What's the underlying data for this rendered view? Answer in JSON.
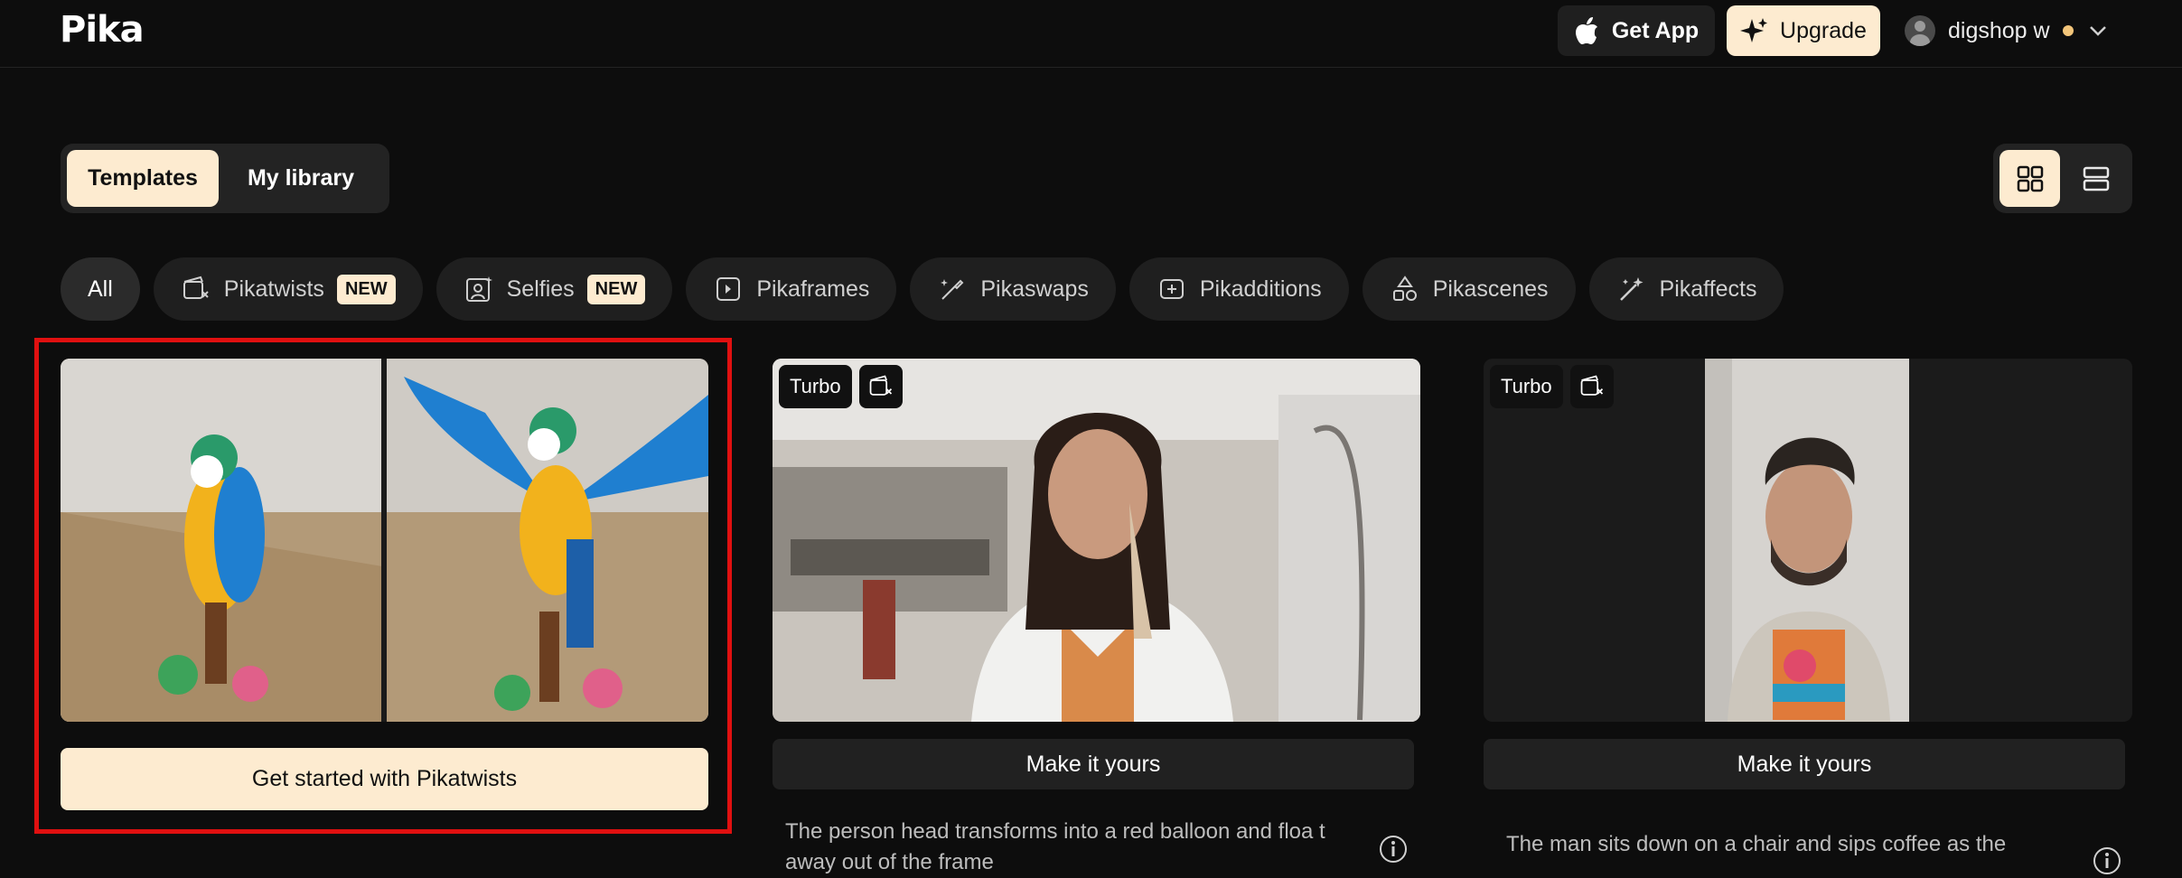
{
  "header": {
    "logo": "Pika",
    "get_app_label": "Get App",
    "upgrade_label": "Upgrade",
    "user_name": "digshop w"
  },
  "tabs": [
    {
      "label": "Templates",
      "active": true
    },
    {
      "label": "My library",
      "active": false
    }
  ],
  "filters": [
    {
      "label": "All",
      "icon": "none"
    },
    {
      "label": "Pikatwists",
      "icon": "twist-icon",
      "badge": "NEW"
    },
    {
      "label": "Selfies",
      "icon": "selfie-icon",
      "badge": "NEW"
    },
    {
      "label": "Pikaframes",
      "icon": "frames-icon"
    },
    {
      "label": "Pikaswaps",
      "icon": "swap-icon"
    },
    {
      "label": "Pikadditions",
      "icon": "additions-icon"
    },
    {
      "label": "Pikascenes",
      "icon": "scenes-icon"
    },
    {
      "label": "Pikaffects",
      "icon": "effects-icon"
    }
  ],
  "cards": [
    {
      "cta": "Get started with Pikatwists"
    },
    {
      "tag": "Turbo",
      "cta": "Make it yours",
      "description": "The person head transforms into a red balloon and floa t away out of the frame"
    },
    {
      "tag": "Turbo",
      "cta": "Make it yours",
      "description": "The man sits down on a chair and sips coffee as the"
    }
  ],
  "colors": {
    "background": "#0d0d0d",
    "accent": "#fdebd0",
    "highlight": "#e01010"
  }
}
